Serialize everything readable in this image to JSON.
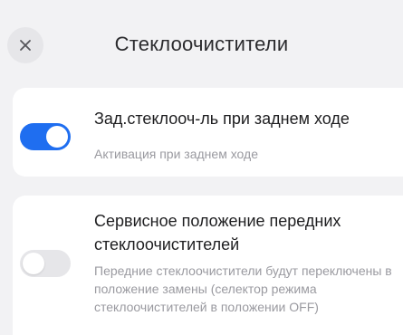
{
  "header": {
    "title": "Стеклоочистители",
    "close_icon": "close-icon"
  },
  "settings": {
    "rear_wiper": {
      "title": "Зад.стеклооч-ль при заднем ходе",
      "description": "Активация при заднем ходе",
      "enabled": true
    },
    "service_position": {
      "title": "Сервисное положение передних стеклоочистителей",
      "description": "Передние стеклоочистители будут переключены в положение замены (селектор режима стеклоочистителей в положении OFF)",
      "enabled": false
    }
  },
  "colors": {
    "background": "#f2f2f4",
    "card": "#ffffff",
    "toggle_on": "#1f6ef0",
    "toggle_off": "#e6e6e9",
    "title_text": "#1e1e20",
    "secondary_text": "#9a9aa0"
  }
}
